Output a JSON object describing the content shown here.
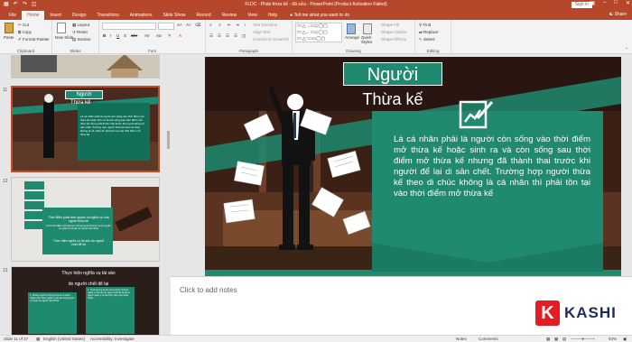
{
  "window": {
    "title": "FLDC - Phân thừa kế - đã sửa - PowerPoint (Product Activation Failed)",
    "sign_in": "Sign in",
    "share": "Share",
    "tell_me": "Tell me what you want to do"
  },
  "tabs": [
    "File",
    "Home",
    "Insert",
    "Design",
    "Transitions",
    "Animations",
    "Slide Show",
    "Record",
    "Review",
    "View",
    "Help"
  ],
  "ribbon": {
    "clipboard": {
      "label": "Clipboard",
      "paste": "Paste",
      "cut": "Cut",
      "copy": "Copy",
      "format_painter": "Format Painter"
    },
    "slides": {
      "label": "Slides",
      "new_slide": "New Slide",
      "layout": "Layout",
      "reset": "Reset",
      "section": "Section"
    },
    "font": {
      "label": "Font"
    },
    "paragraph": {
      "label": "Paragraph",
      "text_direction": "Text Direction",
      "align_text": "Align Text",
      "smartart": "Convert to SmartArt"
    },
    "drawing": {
      "label": "Drawing",
      "arrange": "Arrange",
      "quick_styles": "Quick Styles",
      "shape_fill": "Shape Fill",
      "shape_outline": "Shape Outline",
      "shape_effects": "Shape Effects"
    },
    "editing": {
      "label": "Editing",
      "find": "Find",
      "replace": "Replace",
      "select": "Select"
    }
  },
  "thumbnails": [
    {
      "number": "11",
      "title_line1": "Người",
      "title_line2": "Thừa kế",
      "body": "Là cá nhân phải là người còn sống vào thời điểm mở thừa kế hoặc sinh ra và còn sống sau thời điểm mở thừa kế nhưng đã thành thai trước khi người để lại di sản chết. Trường hợp người thừa kế theo di chúc không là cá nhân thì phải tồn tại vào thời điểm mở thừa kế"
    },
    {
      "number": "12",
      "box1": "Thời điểm phát sinh quyền và nghĩa vụ của người thừa kế",
      "box1_body": "Kể từ thời điểm mở thừa kế, những người thừa kế có các quyền và nghĩa vụ tài sản do người chết để lại",
      "box2": "Thực hiện nghĩa vụ tài sản do người chết để lại"
    },
    {
      "number": "13",
      "title": "Thực hiện nghĩa vụ tài sản",
      "subtitle": "do người chết để lại",
      "col1": "1. Những người hưởng thừa kế có trách nhiệm thực hiện nghĩa vụ tài sản trong phạm vi di sản do người chết để lại",
      "col2": "1. Trường hợp di sản chưa được chia thì nghĩa vụ tài sản do người chết để lại được người quản lý di sản thực hiện theo thỏa thuận"
    }
  ],
  "slide": {
    "title_line1": "Người",
    "title_line2": "Thừa kế",
    "body": "Là cá nhân phải là người còn sống vào thời điểm mở thừa kế hoặc sinh ra và còn sống sau thời điểm mở thừa kế nhưng đã thành thai trước khi người để lại di sản chết. Trường hợp người thừa kế theo di chúc không là cá nhân thì phải tồn tại vào thời điểm mở thừa kế"
  },
  "notes": {
    "placeholder": "Click to add notes"
  },
  "status": {
    "slide_of": "Slide 11 of 37",
    "language": "English (United States)",
    "accessibility": "Accessibility: Investigate",
    "notes": "Notes",
    "comments": "Comments",
    "zoom": "93%"
  },
  "watermark": {
    "letter": "K",
    "text": "KASHI"
  },
  "colors": {
    "accent": "#b7472a",
    "teal": "#1f8a70",
    "teal_dark": "#12705a",
    "slide_bg": "#3a2019"
  }
}
